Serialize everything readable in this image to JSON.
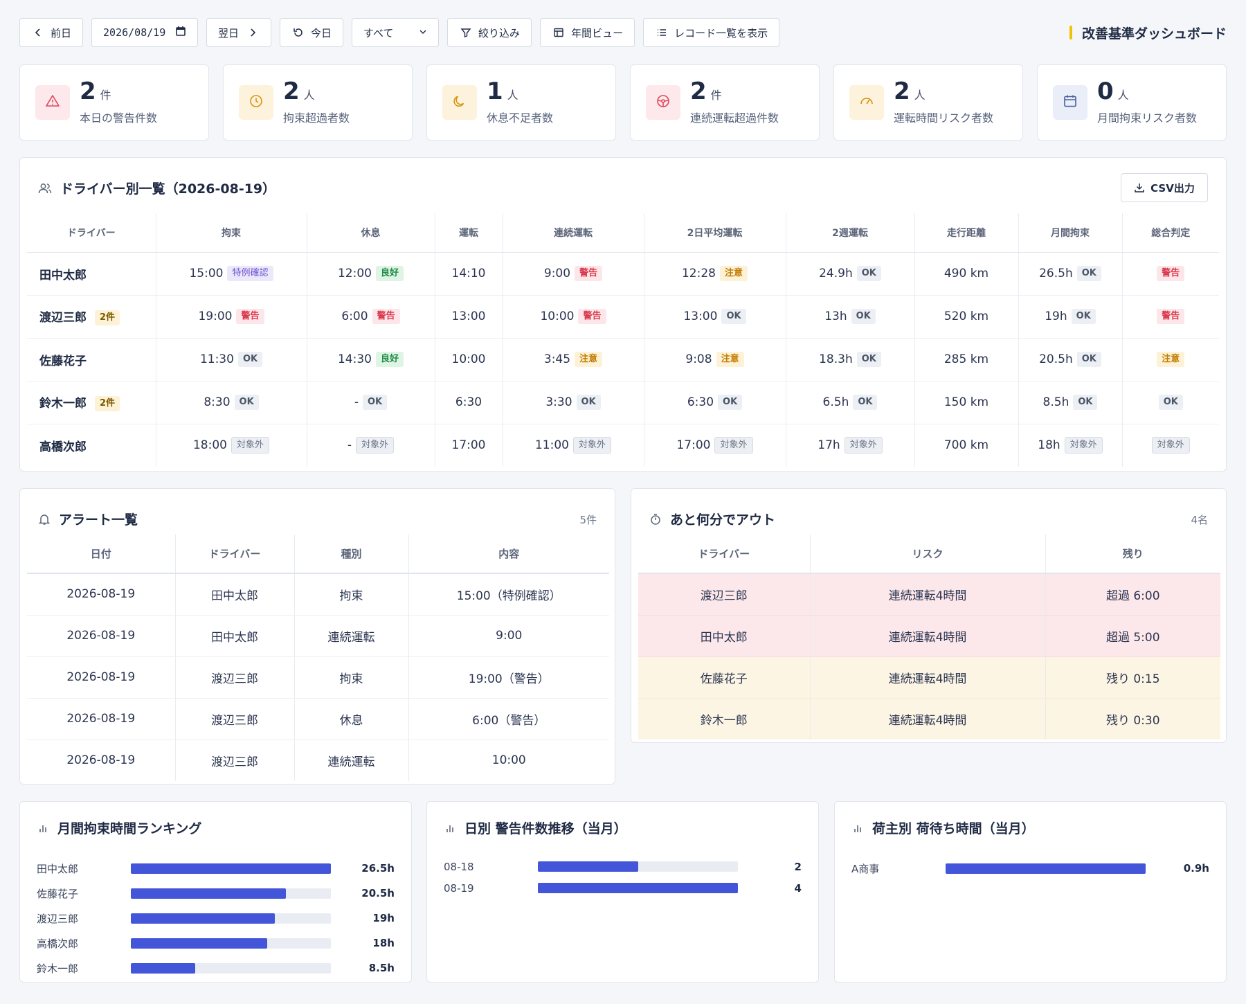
{
  "toolbar": {
    "prev_label": "前日",
    "date_value": "2026/08/19",
    "next_label": "翌日",
    "today_label": "今日",
    "filter_select": "すべて",
    "narrow_label": "絞り込み",
    "year_view_label": "年間ビュー",
    "records_label": "レコード一覧を表示",
    "app_title": "改善基準ダッシュボード"
  },
  "kpis": [
    {
      "value": "2",
      "unit": "件",
      "label": "本日の警告件数",
      "icon": "warning-icon",
      "color": "#e0455a",
      "bg": "#fde8eb"
    },
    {
      "value": "2",
      "unit": "人",
      "label": "拘束超過者数",
      "icon": "clock-icon",
      "color": "#d9920b",
      "bg": "#fdf2dc"
    },
    {
      "value": "1",
      "unit": "人",
      "label": "休息不足者数",
      "icon": "moon-icon",
      "color": "#d9920b",
      "bg": "#fdf2dc"
    },
    {
      "value": "2",
      "unit": "件",
      "label": "連続運転超過件数",
      "icon": "steering-wheel-icon",
      "color": "#e0455a",
      "bg": "#fde8eb"
    },
    {
      "value": "2",
      "unit": "人",
      "label": "運転時間リスク者数",
      "icon": "gauge-icon",
      "color": "#d9920b",
      "bg": "#fdf2dc"
    },
    {
      "value": "0",
      "unit": "人",
      "label": "月間拘束リスク者数",
      "icon": "calendar-icon",
      "color": "#4a5f9a",
      "bg": "#e9eef8"
    }
  ],
  "drivers": {
    "title": "ドライバー別一覧（2026-08-19）",
    "csv_label": "CSV出力",
    "columns": [
      "ドライバー",
      "拘束",
      "休息",
      "運転",
      "連続運転",
      "2日平均運転",
      "2週運転",
      "走行距離",
      "月間拘束",
      "総合判定"
    ],
    "rows": [
      {
        "name": "田中太郎",
        "count": "",
        "cells": [
          {
            "v": "15:00",
            "b": "特例確認",
            "t": "special"
          },
          {
            "v": "12:00",
            "b": "良好",
            "t": "good"
          },
          {
            "v": "14:10",
            "b": "",
            "t": ""
          },
          {
            "v": "9:00",
            "b": "警告",
            "t": "warn"
          },
          {
            "v": "12:28",
            "b": "注意",
            "t": "caution"
          },
          {
            "v": "24.9h",
            "b": "OK",
            "t": "ok"
          },
          {
            "v": "490 km",
            "b": "",
            "t": ""
          },
          {
            "v": "26.5h",
            "b": "OK",
            "t": "ok"
          },
          {
            "v": "",
            "b": "警告",
            "t": "warn"
          }
        ]
      },
      {
        "name": "渡辺三郎",
        "count": "2件",
        "cells": [
          {
            "v": "19:00",
            "b": "警告",
            "t": "warn"
          },
          {
            "v": "6:00",
            "b": "警告",
            "t": "warn"
          },
          {
            "v": "13:00",
            "b": "",
            "t": ""
          },
          {
            "v": "10:00",
            "b": "警告",
            "t": "warn"
          },
          {
            "v": "13:00",
            "b": "OK",
            "t": "ok"
          },
          {
            "v": "13h",
            "b": "OK",
            "t": "ok"
          },
          {
            "v": "520 km",
            "b": "",
            "t": ""
          },
          {
            "v": "19h",
            "b": "OK",
            "t": "ok"
          },
          {
            "v": "",
            "b": "警告",
            "t": "warn"
          }
        ]
      },
      {
        "name": "佐藤花子",
        "count": "",
        "cells": [
          {
            "v": "11:30",
            "b": "OK",
            "t": "ok"
          },
          {
            "v": "14:30",
            "b": "良好",
            "t": "good"
          },
          {
            "v": "10:00",
            "b": "",
            "t": ""
          },
          {
            "v": "3:45",
            "b": "注意",
            "t": "caution"
          },
          {
            "v": "9:08",
            "b": "注意",
            "t": "caution"
          },
          {
            "v": "18.3h",
            "b": "OK",
            "t": "ok"
          },
          {
            "v": "285 km",
            "b": "",
            "t": ""
          },
          {
            "v": "20.5h",
            "b": "OK",
            "t": "ok"
          },
          {
            "v": "",
            "b": "注意",
            "t": "caution"
          }
        ]
      },
      {
        "name": "鈴木一郎",
        "count": "2件",
        "cells": [
          {
            "v": "8:30",
            "b": "OK",
            "t": "ok"
          },
          {
            "v": "-",
            "b": "OK",
            "t": "ok"
          },
          {
            "v": "6:30",
            "b": "",
            "t": ""
          },
          {
            "v": "3:30",
            "b": "OK",
            "t": "ok"
          },
          {
            "v": "6:30",
            "b": "OK",
            "t": "ok"
          },
          {
            "v": "6.5h",
            "b": "OK",
            "t": "ok"
          },
          {
            "v": "150 km",
            "b": "",
            "t": ""
          },
          {
            "v": "8.5h",
            "b": "OK",
            "t": "ok"
          },
          {
            "v": "",
            "b": "OK",
            "t": "ok"
          }
        ]
      },
      {
        "name": "高橋次郎",
        "count": "",
        "cells": [
          {
            "v": "18:00",
            "b": "対象外",
            "t": "out"
          },
          {
            "v": "-",
            "b": "対象外",
            "t": "out"
          },
          {
            "v": "17:00",
            "b": "",
            "t": ""
          },
          {
            "v": "11:00",
            "b": "対象外",
            "t": "out"
          },
          {
            "v": "17:00",
            "b": "対象外",
            "t": "out"
          },
          {
            "v": "17h",
            "b": "対象外",
            "t": "out"
          },
          {
            "v": "700 km",
            "b": "",
            "t": ""
          },
          {
            "v": "18h",
            "b": "対象外",
            "t": "out"
          },
          {
            "v": "",
            "b": "対象外",
            "t": "out"
          }
        ]
      }
    ]
  },
  "alerts": {
    "title": "アラート一覧",
    "count": "5件",
    "columns": [
      "日付",
      "ドライバー",
      "種別",
      "内容"
    ],
    "rows": [
      [
        "2026-08-19",
        "田中太郎",
        "拘束",
        "15:00（特例確認）"
      ],
      [
        "2026-08-19",
        "田中太郎",
        "連続運転",
        "9:00"
      ],
      [
        "2026-08-19",
        "渡辺三郎",
        "拘束",
        "19:00（警告）"
      ],
      [
        "2026-08-19",
        "渡辺三郎",
        "休息",
        "6:00（警告）"
      ],
      [
        "2026-08-19",
        "渡辺三郎",
        "連続運転",
        "10:00"
      ]
    ]
  },
  "countdown": {
    "title": "あと何分でアウト",
    "count": "4名",
    "columns": [
      "ドライバー",
      "リスク",
      "残り"
    ],
    "rows": [
      {
        "cells": [
          "渡辺三郎",
          "連続運転4時間",
          "超過 6:00"
        ],
        "level": "red"
      },
      {
        "cells": [
          "田中太郎",
          "連続運転4時間",
          "超過 5:00"
        ],
        "level": "red"
      },
      {
        "cells": [
          "佐藤花子",
          "連続運転4時間",
          "残り 0:15"
        ],
        "level": "amber"
      },
      {
        "cells": [
          "鈴木一郎",
          "連続運転4時間",
          "残り 0:30"
        ],
        "level": "amber"
      }
    ]
  },
  "ranking": {
    "title": "月間拘束時間ランキング",
    "items": [
      {
        "label": "田中太郎",
        "value": "26.5h",
        "frac": 1.0
      },
      {
        "label": "佐藤花子",
        "value": "20.5h",
        "frac": 0.774
      },
      {
        "label": "渡辺三郎",
        "value": "19h",
        "frac": 0.717
      },
      {
        "label": "高橋次郎",
        "value": "18h",
        "frac": 0.679
      },
      {
        "label": "鈴木一郎",
        "value": "8.5h",
        "frac": 0.321
      }
    ]
  },
  "daily": {
    "title": "日別 警告件数推移（当月）",
    "items": [
      {
        "label": "08-18",
        "value": "2",
        "frac": 0.5
      },
      {
        "label": "08-19",
        "value": "4",
        "frac": 1.0
      }
    ]
  },
  "shipper": {
    "title": "荷主別 荷待ち時間（当月）",
    "items": [
      {
        "label": "A商事",
        "value": "0.9h",
        "frac": 1.0
      }
    ]
  },
  "colors": {
    "accent": "#4355d9",
    "brand_bar": "#f2c200"
  }
}
